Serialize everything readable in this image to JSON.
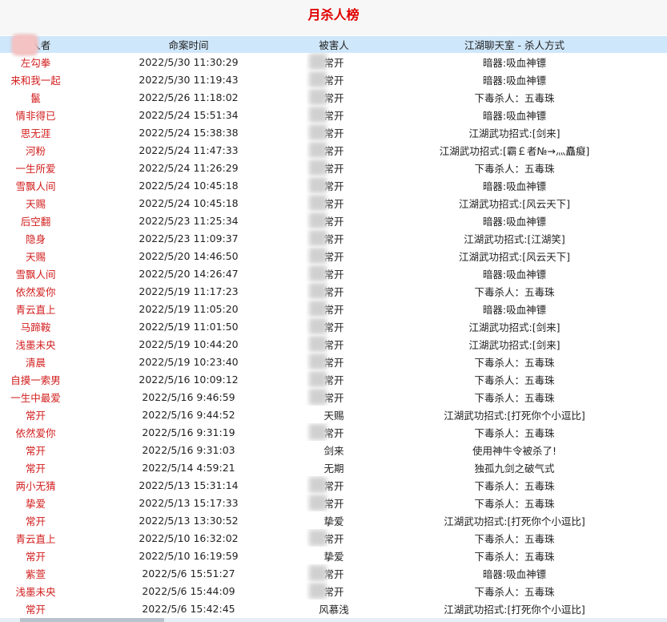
{
  "title": "月杀人榜",
  "headers": {
    "killer": "杀人者",
    "time": "命案时间",
    "victim": "被害人",
    "method": "江湖聊天室 - 杀人方式"
  },
  "rows": [
    {
      "killer": "左勾拳",
      "time": "2022/5/30 11:30:29",
      "victim": "常开",
      "method": "暗器:吸血神镖"
    },
    {
      "killer": "来和我一起",
      "time": "2022/5/30 11:19:43",
      "victim": "常开",
      "method": "暗器:吸血神镖"
    },
    {
      "killer": "鬣",
      "time": "2022/5/26 11:18:02",
      "victim": "常开",
      "method": "下毒杀人：五毒珠"
    },
    {
      "killer": "情非得已",
      "time": "2022/5/24 15:51:34",
      "victim": "常开",
      "method": "暗器:吸血神镖"
    },
    {
      "killer": "思无涯",
      "time": "2022/5/24 15:38:38",
      "victim": "常开",
      "method": "江湖武功招式:[剑来]"
    },
    {
      "killer": "河粉",
      "time": "2022/5/24 11:47:33",
      "victim": "常开",
      "method": "江湖武功招式:[霸￡者№→灬矗癡]"
    },
    {
      "killer": "一生所爱",
      "time": "2022/5/24 11:26:29",
      "victim": "常开",
      "method": "下毒杀人：五毒珠"
    },
    {
      "killer": "雪飘人间",
      "time": "2022/5/24 10:45:18",
      "victim": "常开",
      "method": "暗器:吸血神镖"
    },
    {
      "killer": "天赐",
      "time": "2022/5/24 10:45:18",
      "victim": "常开",
      "method": "江湖武功招式:[风云天下]"
    },
    {
      "killer": "后空翻",
      "time": "2022/5/23 11:25:34",
      "victim": "常开",
      "method": "暗器:吸血神镖"
    },
    {
      "killer": "隐身",
      "time": "2022/5/23 11:09:37",
      "victim": "常开",
      "method": "江湖武功招式:[江湖笑]"
    },
    {
      "killer": "天赐",
      "time": "2022/5/20 14:46:50",
      "victim": "常开",
      "method": "江湖武功招式:[风云天下]"
    },
    {
      "killer": "雪飘人间",
      "time": "2022/5/20 14:26:47",
      "victim": "常开",
      "method": "暗器:吸血神镖"
    },
    {
      "killer": "依然爱你",
      "time": "2022/5/19 11:17:23",
      "victim": "常开",
      "method": "下毒杀人：五毒珠"
    },
    {
      "killer": "青云直上",
      "time": "2022/5/19 11:05:20",
      "victim": "常开",
      "method": "暗器:吸血神镖"
    },
    {
      "killer": "马蹄鞍",
      "time": "2022/5/19 11:01:50",
      "victim": "常开",
      "method": "江湖武功招式:[剑来]"
    },
    {
      "killer": "浅墨未央",
      "time": "2022/5/19 10:44:20",
      "victim": "常开",
      "method": "江湖武功招式:[剑来]"
    },
    {
      "killer": "清晨",
      "time": "2022/5/19 10:23:40",
      "victim": "常开",
      "method": "下毒杀人：五毒珠"
    },
    {
      "killer": "自摸一索男",
      "time": "2022/5/16 10:09:12",
      "victim": "常开",
      "method": "下毒杀人：五毒珠"
    },
    {
      "killer": "一生中最爱",
      "time": "2022/5/16 9:46:59",
      "victim": "常开",
      "method": "下毒杀人：五毒珠"
    },
    {
      "killer": "常开",
      "time": "2022/5/16 9:44:52",
      "victim": "天赐",
      "method": "江湖武功招式:[打死你个小逗比]"
    },
    {
      "killer": "依然爱你",
      "time": "2022/5/16 9:31:19",
      "victim": "常开",
      "method": "下毒杀人：五毒珠"
    },
    {
      "killer": "常开",
      "time": "2022/5/16 9:31:03",
      "victim": "剑来",
      "method": "使用神牛令被杀了!"
    },
    {
      "killer": "常开",
      "time": "2022/5/14 4:59:21",
      "victim": "无期",
      "method": "独孤九剑之破气式"
    },
    {
      "killer": "两小无猜",
      "time": "2022/5/13 15:31:14",
      "victim": "常开",
      "method": "下毒杀人：五毒珠"
    },
    {
      "killer": "挚爱",
      "time": "2022/5/13 15:17:33",
      "victim": "常开",
      "method": "下毒杀人：五毒珠"
    },
    {
      "killer": "常开",
      "time": "2022/5/13 13:30:52",
      "victim": "挚爱",
      "method": "江湖武功招式:[打死你个小逗比]"
    },
    {
      "killer": "青云直上",
      "time": "2022/5/10 16:32:02",
      "victim": "常开",
      "method": "下毒杀人：五毒珠"
    },
    {
      "killer": "常开",
      "time": "2022/5/10 16:19:59",
      "victim": "挚爱",
      "method": "下毒杀人：五毒珠"
    },
    {
      "killer": "紫萱",
      "time": "2022/5/6 15:51:27",
      "victim": "常开",
      "method": "暗器:吸血神镖"
    },
    {
      "killer": "浅墨未央",
      "time": "2022/5/6 15:44:09",
      "victim": "常开",
      "method": "下毒杀人：五毒珠"
    },
    {
      "killer": "常开",
      "time": "2022/5/6 15:42:45",
      "victim": "风慕浅",
      "method": "江湖武功招式:[打死你个小逗比]"
    }
  ]
}
